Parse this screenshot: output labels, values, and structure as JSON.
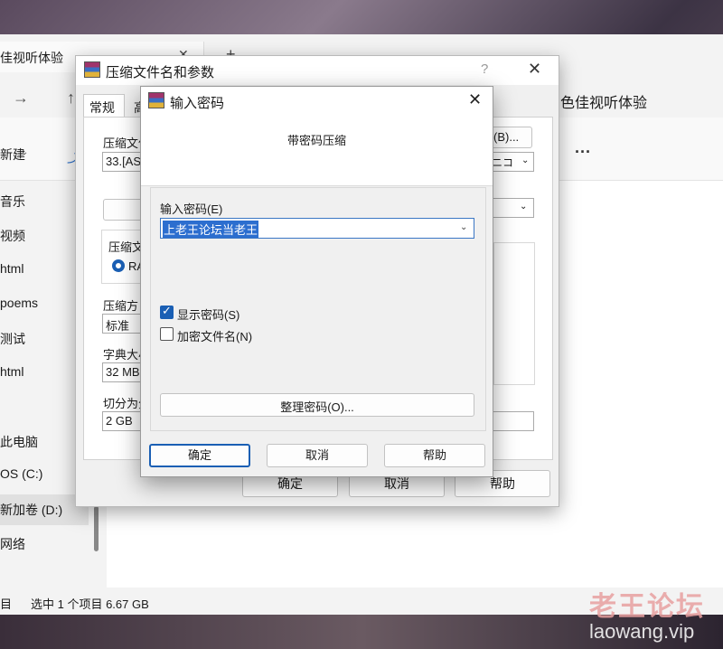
{
  "explorer": {
    "tab_title": "佳视听体验",
    "tab_close": "✕",
    "tab_add": "+",
    "back": "→",
    "up": "↑",
    "address_title": "色佳视听体验",
    "new_label": "新建",
    "more": "···",
    "sidebar": [
      {
        "label": "音乐",
        "y": 0
      },
      {
        "label": "视频",
        "y": 1
      },
      {
        "label": "html",
        "y": 2
      },
      {
        "label": "poems",
        "y": 3
      },
      {
        "label": "测试",
        "y": 4
      },
      {
        "label": "html",
        "y": 5
      },
      {
        "label": "此电脑",
        "y": 6
      },
      {
        "label": "OS (C:)",
        "y": 7
      },
      {
        "label": "新加卷 (D:)",
        "y": 8
      },
      {
        "label": "网络",
        "y": 9
      }
    ],
    "status_items": "目",
    "status_selected": "选中 1 个项目  6.67 GB"
  },
  "archive_dialog": {
    "title": "压缩文件名和参数",
    "help_glyph": "?",
    "close_glyph": "✕",
    "tab_general": "常规",
    "tab_advanced": "高",
    "name_label": "压缩文件",
    "name_value": "33.[AS",
    "browse_label": "(B)...",
    "update_value": "ニコ",
    "format_label": "压缩文",
    "format_rar": "RA",
    "method_label": "压缩方",
    "method_value": "标准",
    "dict_label": "字典大小",
    "dict_value": "32 MB",
    "split_label": "切分为分",
    "split_value": "2 GB",
    "ok_label": "确定",
    "cancel_label": "取消",
    "help_label": "帮助"
  },
  "password_dialog": {
    "title": "输入密码",
    "close_glyph": "✕",
    "header": "带密码压缩",
    "enter_label": "输入密码(E)",
    "password_value": "上老王论坛当老王",
    "show_password_label": "显示密码(S)",
    "show_password_checked": true,
    "encrypt_names_label": "加密文件名(N)",
    "encrypt_names_checked": false,
    "organize_label": "整理密码(O)...",
    "ok_label": "确定",
    "cancel_label": "取消",
    "help_label": "帮助"
  },
  "watermark": {
    "cn": "老王论坛",
    "url": "laowang.vip"
  }
}
